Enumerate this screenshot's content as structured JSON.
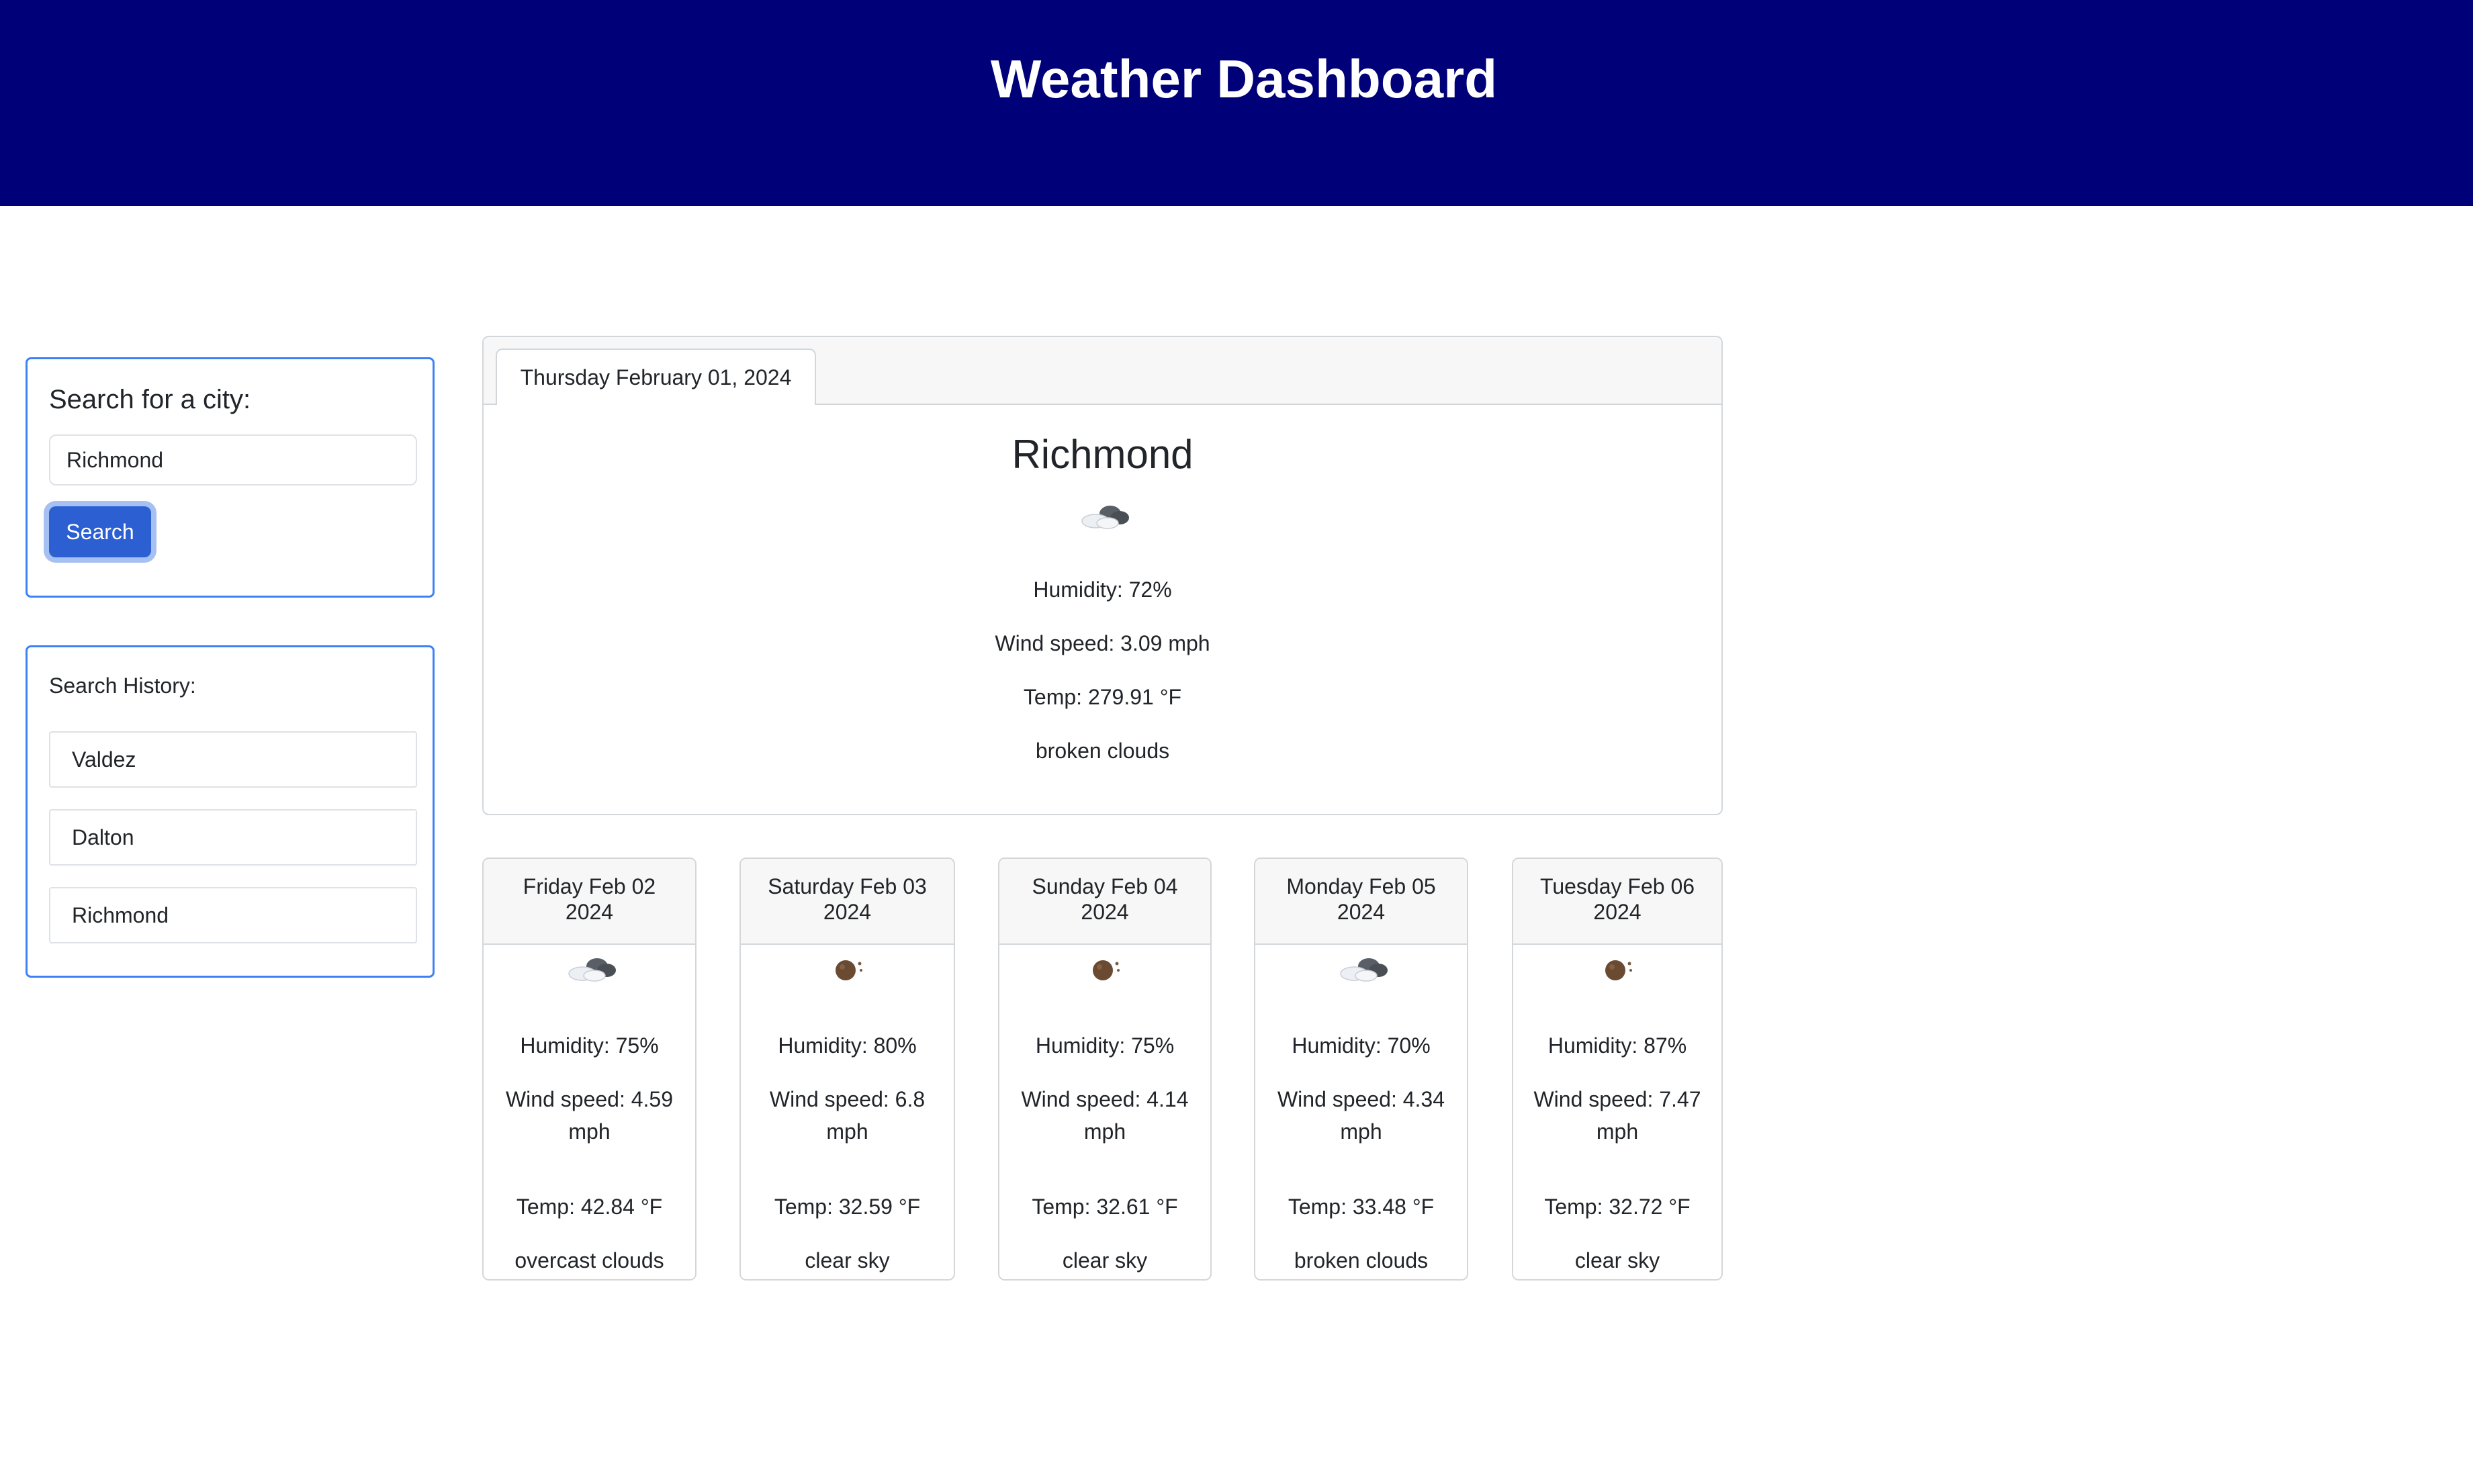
{
  "header": {
    "title": "Weather Dashboard"
  },
  "search": {
    "title": "Search for a city:",
    "value": "Richmond",
    "button_label": "Search"
  },
  "history": {
    "title": "Search History:",
    "items": [
      "Valdez",
      "Dalton",
      "Richmond"
    ]
  },
  "current": {
    "date": "Thursday February 01, 2024",
    "city": "Richmond",
    "icon": "broken-clouds-icon",
    "humidity": "Humidity: 72%",
    "wind": "Wind speed: 3.09 mph",
    "temp": "Temp: 279.91 °F",
    "description": "broken clouds"
  },
  "forecast": [
    {
      "day": "Friday Feb 02",
      "year": "2024",
      "icon": "overcast-clouds-icon",
      "humidity": "Humidity: 75%",
      "wind": "Wind speed: 4.59 mph",
      "temp": "Temp: 42.84 °F",
      "description": "overcast clouds"
    },
    {
      "day": "Saturday Feb 03",
      "year": "2024",
      "icon": "clear-sky-night-icon",
      "humidity": "Humidity: 80%",
      "wind": "Wind speed: 6.8 mph",
      "temp": "Temp: 32.59 °F",
      "description": "clear sky"
    },
    {
      "day": "Sunday Feb 04",
      "year": "2024",
      "icon": "clear-sky-night-icon",
      "humidity": "Humidity: 75%",
      "wind": "Wind speed: 4.14 mph",
      "temp": "Temp: 32.61 °F",
      "description": "clear sky"
    },
    {
      "day": "Monday Feb 05",
      "year": "2024",
      "icon": "broken-clouds-icon",
      "humidity": "Humidity: 70%",
      "wind": "Wind speed: 4.34 mph",
      "temp": "Temp: 33.48 °F",
      "description": "broken clouds"
    },
    {
      "day": "Tuesday Feb 06",
      "year": "2024",
      "icon": "clear-sky-night-icon",
      "humidity": "Humidity: 87%",
      "wind": "Wind speed: 7.47 mph",
      "temp": "Temp: 32.72 °F",
      "description": "clear sky"
    }
  ],
  "colors": {
    "header_bg": "#000079",
    "accent": "#3d82f5",
    "button": "#2b5fd2"
  }
}
